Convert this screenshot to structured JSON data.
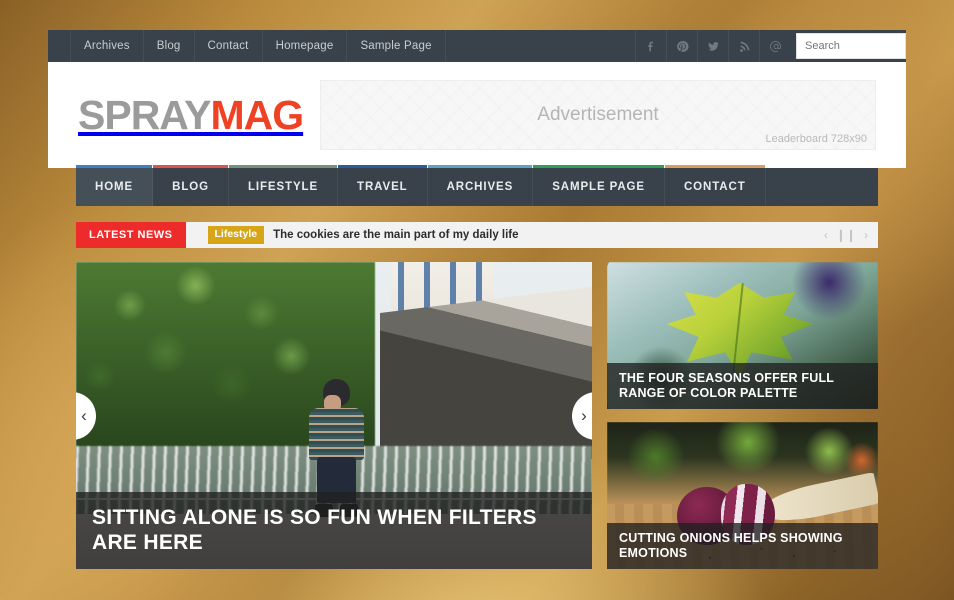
{
  "topbar": {
    "links": [
      {
        "label": "Archives"
      },
      {
        "label": "Blog"
      },
      {
        "label": "Contact"
      },
      {
        "label": "Homepage"
      },
      {
        "label": "Sample Page"
      }
    ],
    "social": [
      {
        "name": "facebook-icon"
      },
      {
        "name": "pinterest-icon"
      },
      {
        "name": "twitter-icon"
      },
      {
        "name": "rss-icon"
      },
      {
        "name": "email-icon"
      }
    ],
    "search": {
      "placeholder": "Search",
      "value": ""
    }
  },
  "header": {
    "logo_part1": "SPRAY",
    "logo_part2": "MAG",
    "logo_color1": "#9b9b9b",
    "logo_color2": "#ef4123",
    "ad": {
      "label": "Advertisement",
      "size": "Leaderboard 728x90"
    }
  },
  "mainnav": {
    "items": [
      {
        "label": "HOME",
        "color": "#3b82c4",
        "active": true
      },
      {
        "label": "BLOG",
        "color": "#d9534f",
        "active": false
      },
      {
        "label": "LIFESTYLE",
        "color": "#7a8f7a",
        "active": false
      },
      {
        "label": "TRAVEL",
        "color": "#2e5b9e",
        "active": false
      },
      {
        "label": "ARCHIVES",
        "color": "#5ba4c4",
        "active": false
      },
      {
        "label": "SAMPLE PAGE",
        "color": "#2e9e5b",
        "active": false
      },
      {
        "label": "CONTACT",
        "color": "#d99e5b",
        "active": false
      }
    ]
  },
  "ticker": {
    "label": "LATEST NEWS",
    "category": "Lifestyle",
    "category_color": "#d6a518",
    "headline": "The cookies are the main part of my daily life",
    "controls": {
      "prev": "‹",
      "pause": "❙❙",
      "next": "›"
    }
  },
  "featured": {
    "slider": {
      "title": "SITTING ALONE IS SO FUN WHEN FILTERS ARE HERE",
      "prev_arrow": "‹",
      "next_arrow": "›"
    },
    "cards": [
      {
        "title": "THE FOUR SEASONS OFFER FULL RANGE OF COLOR PALETTE"
      },
      {
        "title": "CUTTING ONIONS HELPS SHOWING EMOTIONS"
      }
    ]
  }
}
